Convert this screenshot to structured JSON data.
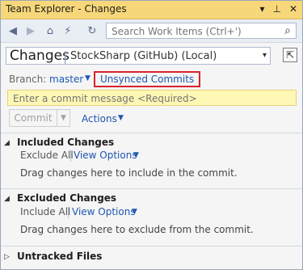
{
  "window": {
    "title": "Team Explorer - Changes",
    "title_icons": [
      "chevron-down-icon",
      "pin-icon",
      "close-icon"
    ]
  },
  "toolbar": {
    "nav_icons": [
      "back-icon",
      "forward-icon",
      "home-icon",
      "connect-icon",
      "refresh-icon"
    ],
    "search_placeholder": "Search Work Items (Ctrl+')"
  },
  "header": {
    "title": "Changes",
    "subtitle": "StockSharp (GitHub) (Local)"
  },
  "branch": {
    "label": "Branch:",
    "name": "master",
    "unsynced_link": "Unsynced Commits"
  },
  "commit": {
    "message_placeholder": "Enter a commit message <Required>",
    "button_label": "Commit",
    "actions_label": "Actions"
  },
  "sections": {
    "included": {
      "title": "Included Changes",
      "action": "Exclude All",
      "view_options": "View Options",
      "note": "Drag changes here to include in the commit."
    },
    "excluded": {
      "title": "Excluded Changes",
      "action": "Include All",
      "view_options": "View Options",
      "note": "Drag changes here to exclude from the commit."
    },
    "untracked": {
      "title": "Untracked Files"
    }
  },
  "colors": {
    "titlebar": "#f7d779",
    "link": "#1e56b2",
    "highlight_border": "#d9232b",
    "commit_message_bg": "#fff8b5"
  }
}
